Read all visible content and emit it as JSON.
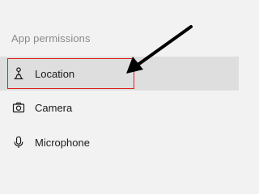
{
  "section": {
    "title": "App permissions"
  },
  "items": [
    {
      "label": "Location",
      "icon": "location-person-icon",
      "selected": true
    },
    {
      "label": "Camera",
      "icon": "camera-icon",
      "selected": false
    },
    {
      "label": "Microphone",
      "icon": "microphone-icon",
      "selected": false
    }
  ],
  "annotation": {
    "highlight_color": "#e02020",
    "arrow_color": "#000000"
  }
}
